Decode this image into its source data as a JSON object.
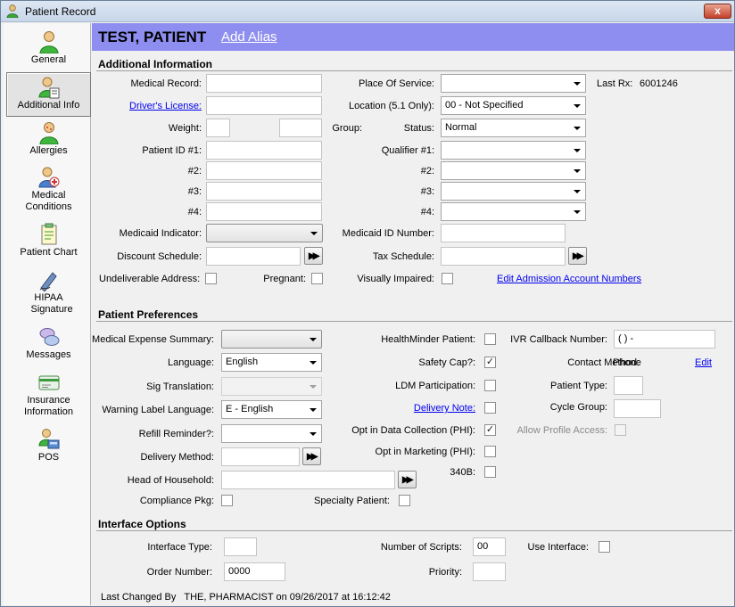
{
  "window": {
    "title": "Patient Record",
    "close_label": "x"
  },
  "sidebar": {
    "items": [
      {
        "label": "General",
        "icon": "person-icon"
      },
      {
        "label": "Additional Info",
        "icon": "person-info-icon",
        "selected": true
      },
      {
        "label": "Allergies",
        "icon": "allergy-icon"
      },
      {
        "label": "Medical Conditions",
        "icon": "medical-conditions-icon"
      },
      {
        "label": "Patient Chart",
        "icon": "chart-icon"
      },
      {
        "label": "HIPAA Signature",
        "icon": "signature-icon"
      },
      {
        "label": "Messages",
        "icon": "messages-icon"
      },
      {
        "label": "Insurance Information",
        "icon": "insurance-card-icon"
      },
      {
        "label": "POS",
        "icon": "pos-icon"
      }
    ]
  },
  "header": {
    "patient_name": "TEST, PATIENT",
    "add_alias": "Add Alias"
  },
  "additional": {
    "title": "Additional Information",
    "medical_record_label": "Medical Record:",
    "medical_record": "",
    "drivers_license_label": "Driver's License:",
    "drivers_license": "",
    "weight_label": "Weight:",
    "weight": "",
    "group_label": "Group:",
    "group": "",
    "patient_id_1_label": "Patient ID #1:",
    "id2_label": "#2:",
    "id3_label": "#3:",
    "id4_label": "#4:",
    "medicaid_indicator_label": "Medicaid Indicator:",
    "medicaid_indicator": "",
    "discount_schedule_label": "Discount Schedule:",
    "discount_schedule": "",
    "undeliverable_label": "Undeliverable Address:",
    "pregnant_label": "Pregnant:",
    "place_of_service_label": "Place Of Service:",
    "place_of_service": "",
    "last_rx_label": "Last Rx:",
    "last_rx": "6001246",
    "location_label": "Location (5.1 Only):",
    "location": "00 - Not Specified",
    "status_label": "Status:",
    "status": "Normal",
    "qualifier_1_label": "Qualifier #1:",
    "q2_label": "#2:",
    "q3_label": "#3:",
    "q4_label": "#4:",
    "medicaid_id_label": "Medicaid ID Number:",
    "medicaid_id": "",
    "tax_schedule_label": "Tax Schedule:",
    "tax_schedule": "",
    "visually_impaired_label": "Visually Impaired:",
    "edit_admission": "Edit Admission Account Numbers"
  },
  "preferences": {
    "title": "Patient Preferences",
    "medical_expense_label": "Medical Expense Summary:",
    "medical_expense": "",
    "language_label": "Language:",
    "language": "English",
    "sig_translation_label": "Sig Translation:",
    "sig_translation": "",
    "warning_label_language_label": "Warning Label Language:",
    "warning_label_language": "E - English",
    "refill_reminder_label": "Refill Reminder?:",
    "refill_reminder": "",
    "delivery_method_label": "Delivery Method:",
    "delivery_method": "",
    "head_of_household_label": "Head of Household:",
    "head_of_household": "",
    "compliance_pkg_label": "Compliance Pkg:",
    "specialty_patient_label": "Specialty Patient:",
    "healthminder_label": "HealthMinder Patient:",
    "safety_cap_label": "Safety Cap?:",
    "safety_cap_mark": "✓",
    "ldm_label": "LDM Participation:",
    "delivery_note_label": "Delivery Note:",
    "opt_data_label": "Opt in Data Collection (PHI):",
    "opt_data_mark": "✓",
    "opt_marketing_label": "Opt in Marketing (PHI):",
    "b340_label": "340B:",
    "ivr_label": "IVR Callback Number:",
    "ivr_value": "(  )   -",
    "contact_method_label": "Contact Method:",
    "contact_method": "Phone",
    "edit_label": "Edit",
    "patient_type_label": "Patient Type:",
    "patient_type": "",
    "cycle_group_label": "Cycle Group:",
    "cycle_group": "",
    "allow_profile_label": "Allow Profile Access:"
  },
  "interface": {
    "title": "Interface Options",
    "interface_type_label": "Interface Type:",
    "interface_type": "",
    "order_number_label": "Order Number:",
    "order_number": "0000",
    "num_scripts_label": "Number of Scripts:",
    "num_scripts": "00",
    "priority_label": "Priority:",
    "priority": "",
    "use_interface_label": "Use Interface:"
  },
  "footer": {
    "last_changed": "Last Changed By   THE, PHARMACIST on 09/26/2017 at 16:12:42"
  }
}
